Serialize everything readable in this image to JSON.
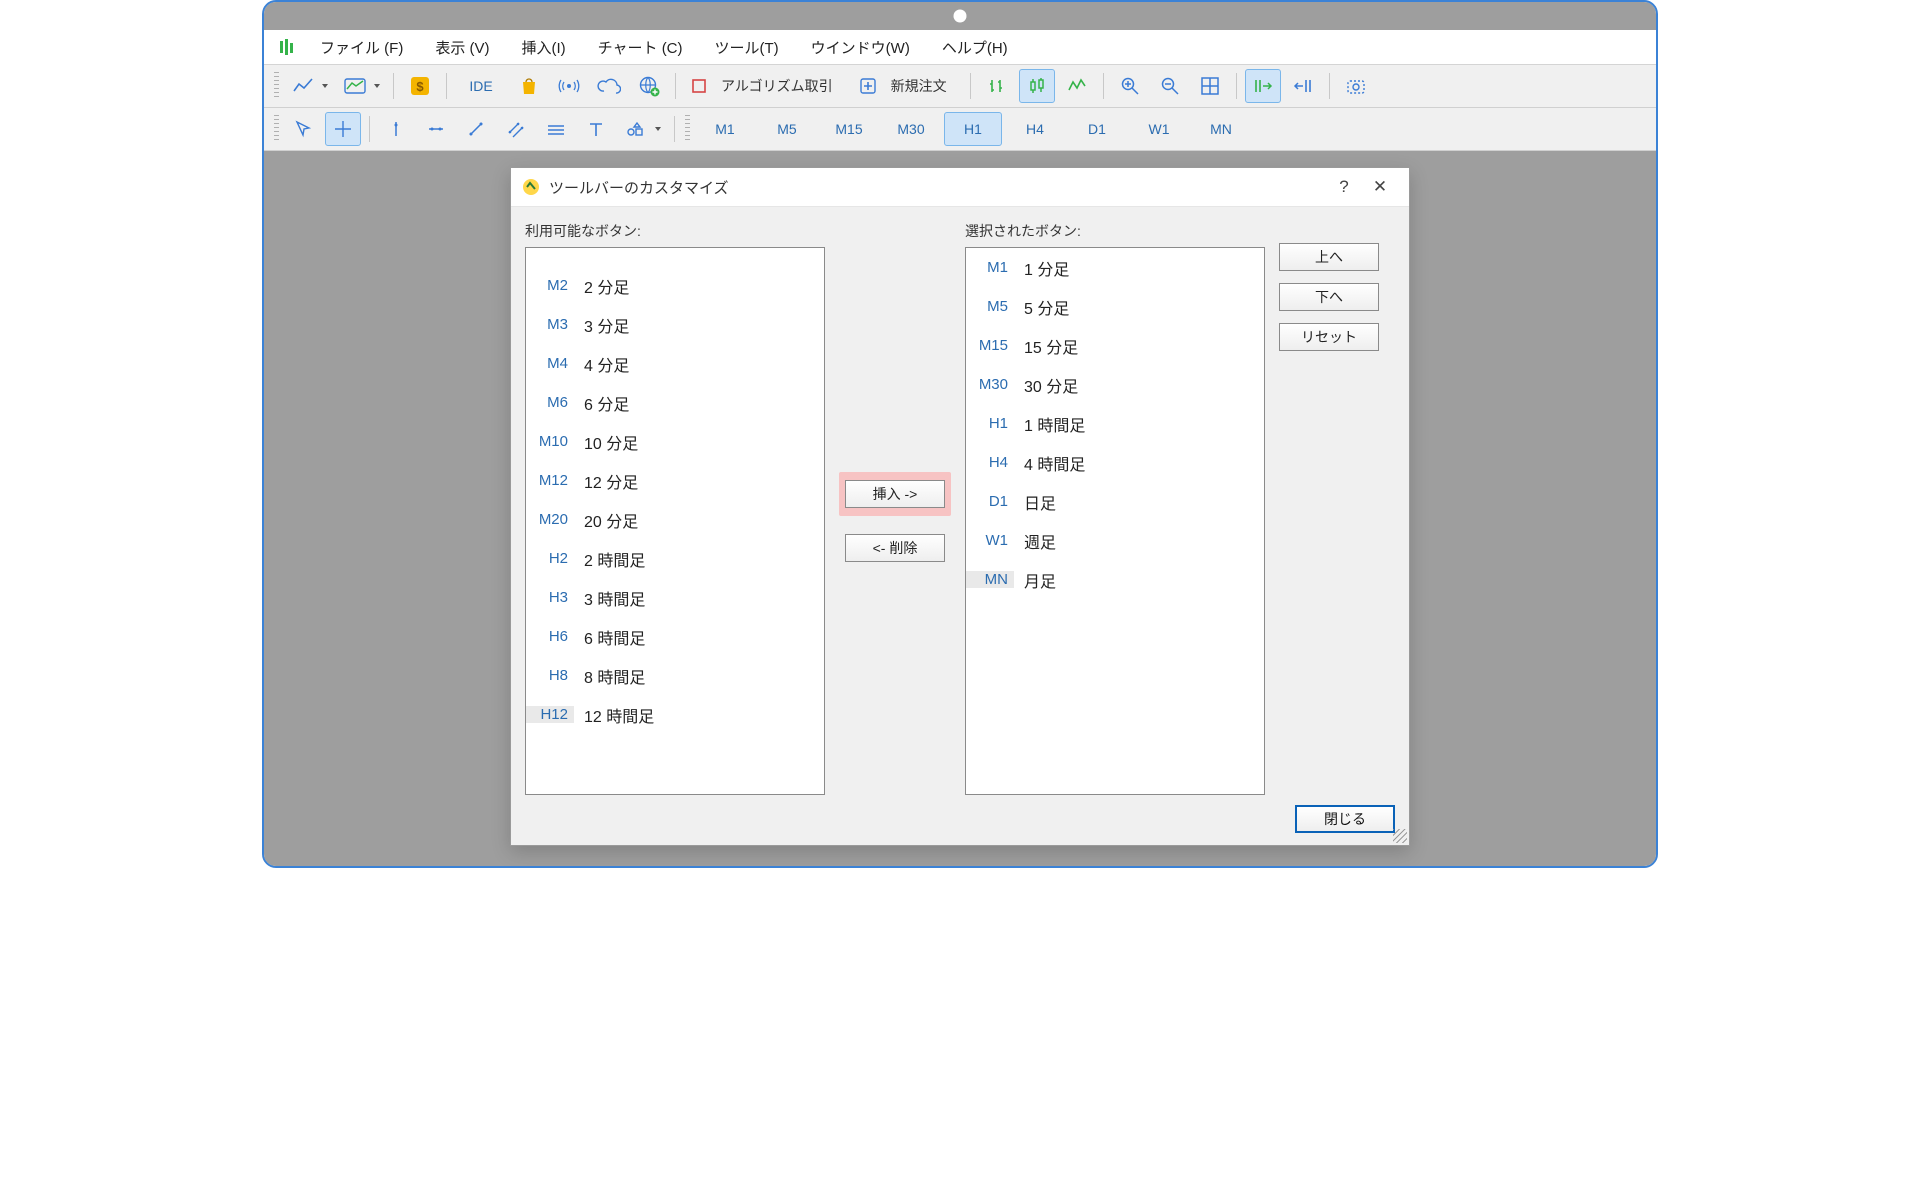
{
  "menu": {
    "file": "ファイル (F)",
    "view": "表示 (V)",
    "insert": "挿入(I)",
    "chart": "チャート (C)",
    "tool": "ツール(T)",
    "window": "ウインドウ(W)",
    "help": "ヘルプ(H)"
  },
  "toolbar1": {
    "ide": "IDE",
    "algo_label": "アルゴリズム取引",
    "new_order": "新規注文"
  },
  "timeframes_bar": [
    "M1",
    "M5",
    "M15",
    "M30",
    "H1",
    "H4",
    "D1",
    "W1",
    "MN"
  ],
  "dialog": {
    "title": "ツールバーのカスタマイズ",
    "available_label": "利用可能なボタン:",
    "selected_label": "選択されたボタン:",
    "insert_btn": "挿入 ->",
    "remove_btn": "<- 削除",
    "up_btn": "上へ",
    "down_btn": "下へ",
    "reset_btn": "リセット",
    "close_btn": "閉じる"
  },
  "available": [
    {
      "code": "M2",
      "label": "2 分足"
    },
    {
      "code": "M3",
      "label": "3 分足"
    },
    {
      "code": "M4",
      "label": "4 分足"
    },
    {
      "code": "M6",
      "label": "6 分足"
    },
    {
      "code": "M10",
      "label": "10 分足"
    },
    {
      "code": "M12",
      "label": "12 分足"
    },
    {
      "code": "M20",
      "label": "20 分足"
    },
    {
      "code": "H2",
      "label": "2 時間足"
    },
    {
      "code": "H3",
      "label": "3 時間足"
    },
    {
      "code": "H6",
      "label": "6 時間足"
    },
    {
      "code": "H8",
      "label": "8 時間足"
    },
    {
      "code": "H12",
      "label": "12 時間足"
    }
  ],
  "selected": [
    {
      "code": "M1",
      "label": "1 分足"
    },
    {
      "code": "M5",
      "label": "5 分足"
    },
    {
      "code": "M15",
      "label": "15 分足"
    },
    {
      "code": "M30",
      "label": "30 分足"
    },
    {
      "code": "H1",
      "label": "1 時間足"
    },
    {
      "code": "H4",
      "label": "4 時間足"
    },
    {
      "code": "D1",
      "label": "日足"
    },
    {
      "code": "W1",
      "label": "週足"
    },
    {
      "code": "MN",
      "label": "月足"
    }
  ]
}
